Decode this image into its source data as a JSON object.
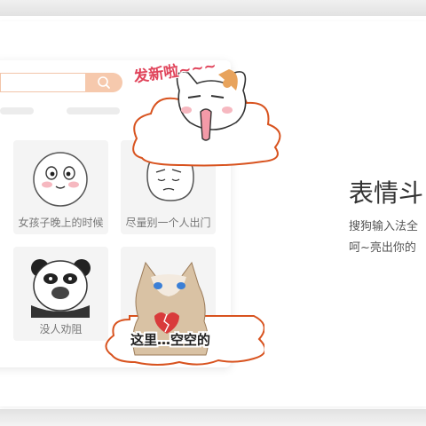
{
  "banner": {
    "sticker_caption": "发新啦~~~",
    "empty_caption": "这里…空空的"
  },
  "panel": {
    "tiles": [
      {
        "label": "女孩子晚上的时候"
      },
      {
        "label": "尽量别一个人出门"
      },
      {
        "label": "没人劝阻"
      }
    ]
  },
  "feature": {
    "title": "表情斗",
    "desc_line1": "搜狗输入法全",
    "desc_line2": "呵~亮出你的"
  },
  "colors": {
    "accent": "#f6c9ad",
    "cloud_stroke": "#d8531f",
    "sticker_text": "#e0435a"
  },
  "icons": {
    "search": "search-icon"
  }
}
